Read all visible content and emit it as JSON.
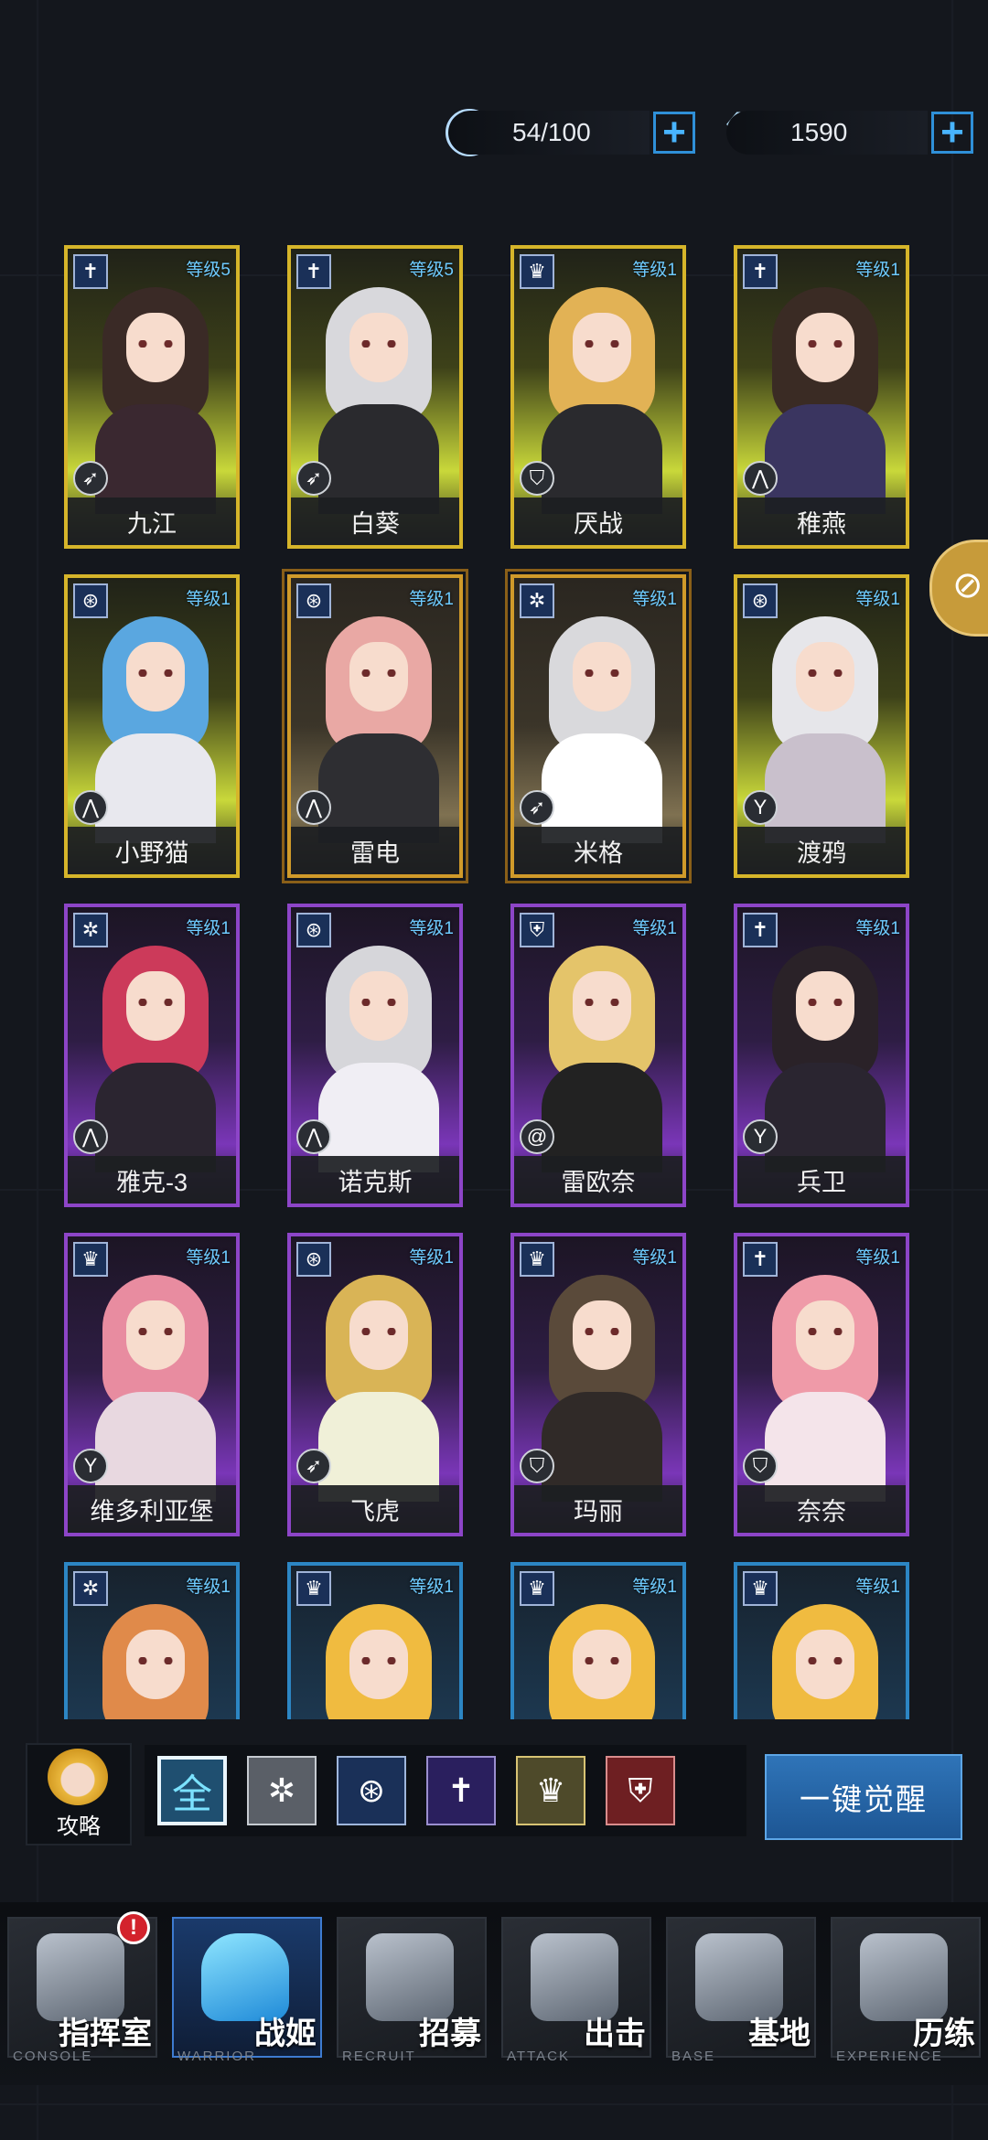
{
  "resources": {
    "energy": {
      "value": "54/100",
      "icon": "energy-icon",
      "plus": "+"
    },
    "gems": {
      "value": "1590",
      "icon": "diamond-icon",
      "plus": "+"
    }
  },
  "cards": [
    {
      "name": "九江",
      "level": "等级5",
      "rarity": "gold",
      "type": "sword",
      "class": "speed"
    },
    {
      "name": "白葵",
      "level": "等级5",
      "rarity": "gold",
      "type": "sword",
      "class": "speed"
    },
    {
      "name": "厌战",
      "level": "等级1",
      "rarity": "gold",
      "type": "lion",
      "class": "shield"
    },
    {
      "name": "稚燕",
      "level": "等级1",
      "rarity": "gold",
      "type": "sword",
      "class": "wings"
    },
    {
      "name": "小野猫",
      "level": "等级1",
      "rarity": "gold",
      "type": "wing-emblem",
      "class": "wings"
    },
    {
      "name": "雷电",
      "level": "等级1",
      "rarity": "goldframe",
      "type": "wing-emblem",
      "class": "wings"
    },
    {
      "name": "米格",
      "level": "等级1",
      "rarity": "goldframe",
      "type": "snowflake",
      "class": "speed"
    },
    {
      "name": "渡鸦",
      "level": "等级1",
      "rarity": "gold",
      "type": "wing-emblem",
      "class": "fork"
    },
    {
      "name": "雅克-3",
      "level": "等级1",
      "rarity": "purple",
      "type": "snowflake",
      "class": "wings"
    },
    {
      "name": "诺克斯",
      "level": "等级1",
      "rarity": "purple",
      "type": "wing-emblem",
      "class": "wings"
    },
    {
      "name": "雷欧奈",
      "level": "等级1",
      "rarity": "purple",
      "type": "shield-crest",
      "class": "swirl"
    },
    {
      "name": "兵卫",
      "level": "等级1",
      "rarity": "purple",
      "type": "sword",
      "class": "fork"
    },
    {
      "name": "维多利亚堡",
      "level": "等级1",
      "rarity": "purple",
      "type": "lion",
      "class": "fork"
    },
    {
      "name": "飞虎",
      "level": "等级1",
      "rarity": "purple",
      "type": "wing-emblem",
      "class": "speed"
    },
    {
      "name": "玛丽",
      "level": "等级1",
      "rarity": "purple",
      "type": "lion",
      "class": "shield"
    },
    {
      "name": "奈奈",
      "level": "等级1",
      "rarity": "purple",
      "type": "sword",
      "class": "shield"
    },
    {
      "name": "",
      "level": "等级1",
      "rarity": "blue",
      "type": "snowflake",
      "class": ""
    },
    {
      "name": "",
      "level": "等级1",
      "rarity": "blue",
      "type": "lion",
      "class": ""
    },
    {
      "name": "",
      "level": "等级1",
      "rarity": "blue",
      "type": "lion",
      "class": ""
    },
    {
      "name": "",
      "level": "等级1",
      "rarity": "blue",
      "type": "lion",
      "class": ""
    }
  ],
  "filter": {
    "guide_label": "攻略",
    "all_label": "全",
    "awaken_button": "一键觉醒"
  },
  "nav": [
    {
      "cn": "指挥室",
      "en": "CONSOLE",
      "icon": "console-icon",
      "alert": "!"
    },
    {
      "cn": "战姬",
      "en": "WARRIOR",
      "icon": "warrior-icon",
      "active": true
    },
    {
      "cn": "招募",
      "en": "RECRUIT",
      "icon": "recruit-icon"
    },
    {
      "cn": "出击",
      "en": "ATTACK",
      "icon": "attack-icon"
    },
    {
      "cn": "基地",
      "en": "BASE",
      "icon": "base-icon"
    },
    {
      "cn": "历练",
      "en": "EXPERIENCE",
      "icon": "experience-icon"
    }
  ],
  "side_tab": {
    "icon": "paperclip-icon",
    "glyph": "⊘"
  }
}
